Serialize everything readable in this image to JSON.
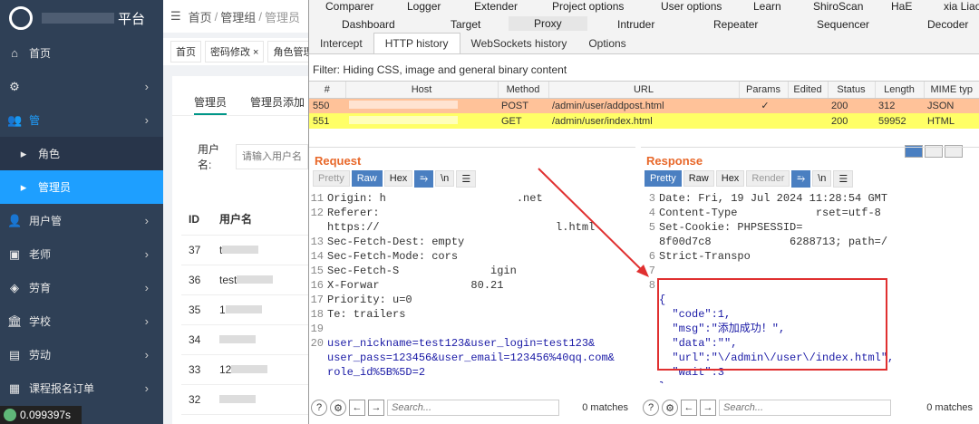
{
  "admin": {
    "brand": "平台",
    "menu": [
      {
        "label": "首页",
        "icon": "home-icon",
        "chev": false
      },
      {
        "label": "",
        "icon": "gear-icon",
        "chev": true
      },
      {
        "label": "管",
        "icon": "group-icon",
        "chev": true
      },
      {
        "label": "角色",
        "icon": "",
        "chev": false
      },
      {
        "label": "管理员",
        "icon": "",
        "chev": false
      },
      {
        "label": "用户管",
        "icon": "user-icon",
        "chev": true
      },
      {
        "label": "老师",
        "icon": "id-card-icon",
        "chev": true
      },
      {
        "label": "劳育",
        "icon": "box-icon",
        "chev": true
      },
      {
        "label": "学校",
        "icon": "bank-icon",
        "chev": true
      },
      {
        "label": "劳动",
        "icon": "briefcase-icon",
        "chev": true
      },
      {
        "label": "课程报名订单",
        "icon": "calendar-icon",
        "chev": true
      }
    ],
    "fps": "0.099397s",
    "breadcrumb": {
      "home": "首页",
      "group": "管理组",
      "current": "管理员"
    },
    "tabs": [
      "首页",
      "密码修改 ×",
      "角色管理"
    ],
    "subtabs": [
      "管理员",
      "管理员添加"
    ],
    "search": {
      "label": "用户名:",
      "placeholder": "请输入用户名"
    },
    "table": {
      "headers": [
        "ID",
        "用户名"
      ],
      "rows": [
        {
          "id": "37",
          "name": "t"
        },
        {
          "id": "36",
          "name": "test"
        },
        {
          "id": "35",
          "name": "1"
        },
        {
          "id": "34",
          "name": ""
        },
        {
          "id": "33",
          "name": "12"
        },
        {
          "id": "32",
          "name": ""
        }
      ]
    }
  },
  "burp": {
    "top_tabs": [
      "Comparer",
      "Logger",
      "Extender",
      "Project options",
      "User options",
      "Learn",
      "ShiroScan",
      "HaE",
      "xia Liao"
    ],
    "second_tabs": [
      "Dashboard",
      "Target",
      "Proxy",
      "Intruder",
      "Repeater",
      "Sequencer",
      "Decoder"
    ],
    "proxy_tabs": [
      "Intercept",
      "HTTP history",
      "WebSockets history",
      "Options"
    ],
    "filter": "Filter: Hiding CSS, image and general binary content",
    "columns": [
      "#",
      "Host",
      "Method",
      "URL",
      "Params",
      "Edited",
      "Status",
      "Length",
      "MIME typ"
    ],
    "rows": [
      {
        "num": "550",
        "method": "POST",
        "url": "/admin/user/addpost.html",
        "params": "✓",
        "status": "200",
        "length": "312",
        "mime": "JSON"
      },
      {
        "num": "551",
        "method": "GET",
        "url": "/admin/user/index.html",
        "params": "",
        "status": "200",
        "length": "59952",
        "mime": "HTML"
      }
    ],
    "request": {
      "title": "Request",
      "buttons": [
        "Pretty",
        "Raw",
        "Hex",
        "⥱",
        "\\n",
        "☰"
      ],
      "lines": [
        {
          "n": "11",
          "t": "Origin: h                    .net"
        },
        {
          "n": "12",
          "t": "Referer:"
        },
        {
          "n": "",
          "t": "https://                           l.html"
        },
        {
          "n": "13",
          "t": "Sec-Fetch-Dest: empty"
        },
        {
          "n": "14",
          "t": "Sec-Fetch-Mode: cors"
        },
        {
          "n": "15",
          "t": "Sec-Fetch-S              igin"
        },
        {
          "n": "16",
          "t": "X-Forwar              80.21"
        },
        {
          "n": "17",
          "t": "Priority: u=0"
        },
        {
          "n": "18",
          "t": "Te: trailers"
        },
        {
          "n": "19",
          "t": ""
        },
        {
          "n": "20",
          "t": "user_nickname=test123&user_login=test123&"
        },
        {
          "n": "",
          "t": "user_pass=123456&user_email=123456%40qq.com&"
        },
        {
          "n": "",
          "t": "role_id%5B%5D=2"
        }
      ]
    },
    "response": {
      "title": "Response",
      "buttons": [
        "Pretty",
        "Raw",
        "Hex",
        "Render",
        "⥱",
        "\\n",
        "☰"
      ],
      "lines": [
        {
          "n": "3",
          "t": "Date: Fri, 19 Jul 2024 11:28:54 GMT"
        },
        {
          "n": "4",
          "t": "Content-Type            rset=utf-8"
        },
        {
          "n": "5",
          "t": "Set-Cookie: PHPSESSID="
        },
        {
          "n": "",
          "t": "8f00d7c8            6288713; path=/"
        },
        {
          "n": "6",
          "t": "Strict-Transpo"
        },
        {
          "n": "7",
          "t": ""
        },
        {
          "n": "8",
          "t": ""
        },
        {
          "n": "",
          "t": "{"
        },
        {
          "n": "",
          "t": "  \"code\":1,"
        },
        {
          "n": "",
          "t": "  \"msg\":\"添加成功！\","
        },
        {
          "n": "",
          "t": "  \"data\":\"\","
        },
        {
          "n": "",
          "t": "  \"url\":\"\\/admin\\/user\\/index.html\","
        },
        {
          "n": "",
          "t": "  \"wait\":3"
        },
        {
          "n": "",
          "t": "}"
        }
      ]
    },
    "search_placeholder": "Search...",
    "matches": "0 matches",
    "highlight_color": "#e03030",
    "row550_color": "#ffc299",
    "row551_color": "#ffff66"
  }
}
